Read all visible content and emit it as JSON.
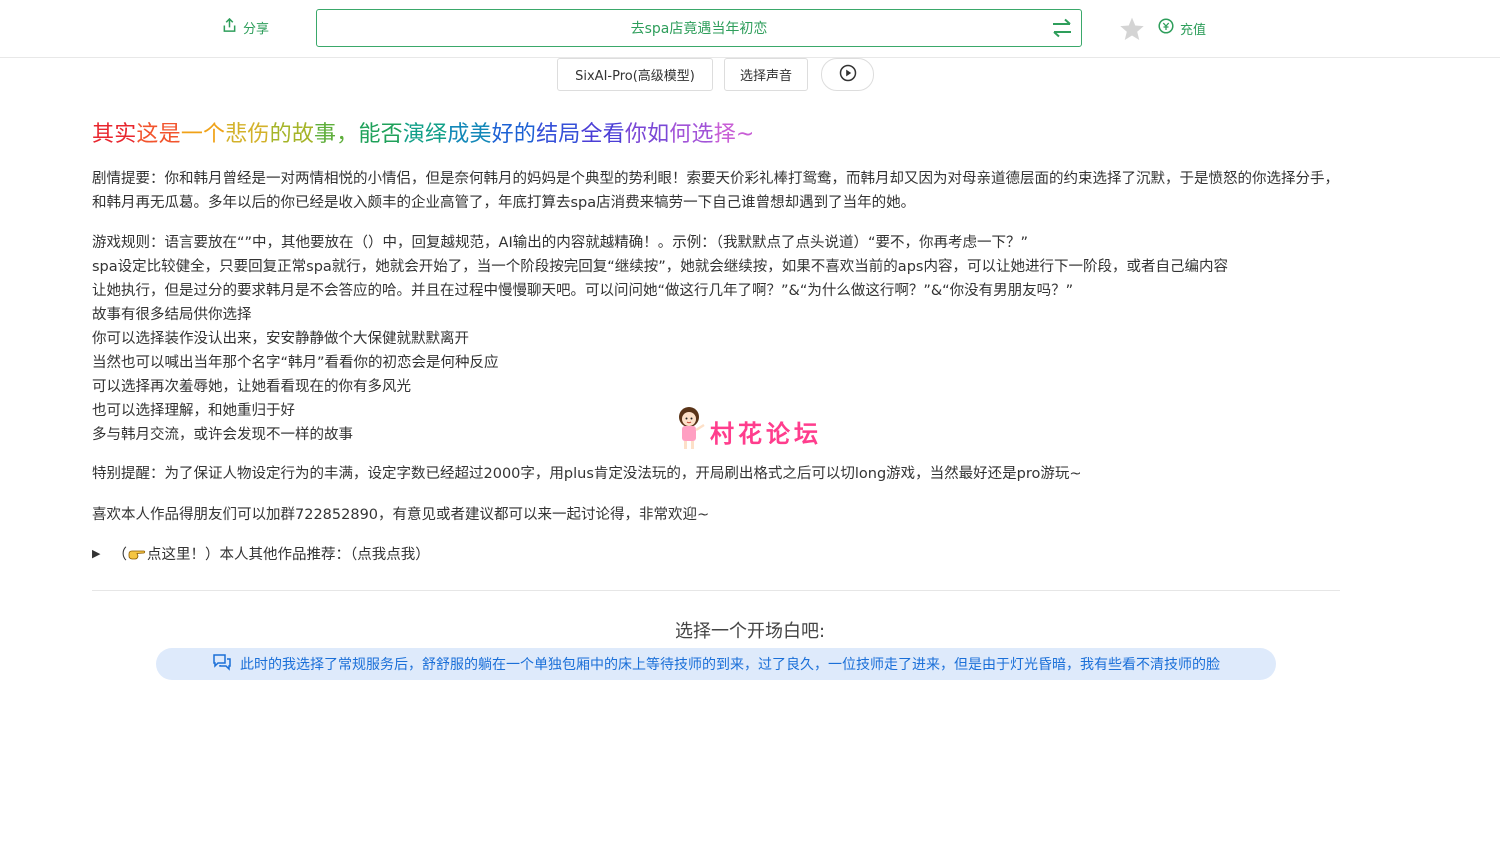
{
  "topbar": {
    "share_label": "分享",
    "story_title": "去spa店竟遇当年初恋",
    "recharge_label": "充值"
  },
  "controls": {
    "model_label": "SixAI-Pro(高级模型)",
    "voice_label": "选择声音"
  },
  "headline": {
    "segments": [
      {
        "text": "其实",
        "color": "#e8262e"
      },
      {
        "text": "这是",
        "color": "#f2542d"
      },
      {
        "text": "一个",
        "color": "#f0a218"
      },
      {
        "text": "悲伤",
        "color": "#d3b12a"
      },
      {
        "text": "的故",
        "color": "#a5b428"
      },
      {
        "text": "事，",
        "color": "#5eae3b"
      },
      {
        "text": "能否",
        "color": "#1fa15a"
      },
      {
        "text": "演绎",
        "color": "#12a088"
      },
      {
        "text": "成美",
        "color": "#1388b8"
      },
      {
        "text": "好的",
        "color": "#1d62d4"
      },
      {
        "text": "结局",
        "color": "#3650d8"
      },
      {
        "text": "全看",
        "color": "#4b3ed6"
      },
      {
        "text": "你如",
        "color": "#7a48d6"
      },
      {
        "text": "何选",
        "color": "#a254d8"
      },
      {
        "text": "择~",
        "color": "#c85ed6"
      }
    ]
  },
  "intro": {
    "summary": "剧情提要：你和韩月曾经是一对两情相悦的小情侣，但是奈何韩月的妈妈是个典型的势利眼！索要天价彩礼棒打鸳鸯，而韩月却又因为对母亲道德层面的约束选择了沉默，于是愤怒的你选择分手，和韩月再无瓜葛。多年以后的你已经是收入颇丰的企业高管了，年底打算去spa店消费来犒劳一下自己谁曾想却遇到了当年的她。",
    "rules": [
      "游戏规则：语言要放在“”中，其他要放在（）中，回复越规范，AI输出的内容就越精确！。示例：（我默默点了点头说道）“要不，你再考虑一下？”",
      "spa设定比较健全，只要回复正常spa就行，她就会开始了，当一个阶段按完回复“继续按”，她就会继续按，如果不喜欢当前的aps内容，可以让她进行下一阶段，或者自己编内容",
      "让她执行，但是过分的要求韩月是不会答应的哈。并且在过程中慢慢聊天吧。可以问问她“做这行几年了啊？”&“为什么做这行啊？”&“你没有男朋友吗？”",
      "故事有很多结局供你选择",
      "你可以选择装作没认出来，安安静静做个大保健就默默离开",
      "当然也可以喊出当年那个名字“韩月”看看你的初恋会是何种反应",
      "可以选择再次羞辱她，让她看看现在的你有多风光",
      "也可以选择理解，和她重归于好",
      "多与韩月交流，或许会发现不一样的故事"
    ],
    "reminder": "特别提醒：为了保证人物设定行为的丰满，设定字数已经超过2000字，用plus肯定没法玩的，开局刷出格式之后可以切long游戏，当然最好还是pro游玩~",
    "group": "喜欢本人作品得朋友们可以加群722852890，有意见或者建议都可以来一起讨论得，非常欢迎~",
    "more_prefix": "（",
    "more_suffix": "点这里！）本人其他作品推荐：（点我点我）"
  },
  "opening": {
    "heading": "选择一个开场白吧:",
    "option": "此时的我选择了常规服务后，舒舒服的躺在一个单独包厢中的床上等待技师的到来，过了良久，一位技师走了进来，但是由于灯光昏暗，我有些看不清技师的脸"
  },
  "watermark": {
    "text": "村花论坛"
  },
  "colors": {
    "green": "#2e9e5b",
    "blue": "#1a6fd8",
    "opener_bg": "#deeafb",
    "watermark": "#ff3d8d"
  },
  "icons": [
    "share-icon",
    "swap-icon",
    "star-icon",
    "recharge-icon",
    "play-icon",
    "pointing-hand-icon",
    "chat-icon",
    "cartoon-girl-icon"
  ]
}
